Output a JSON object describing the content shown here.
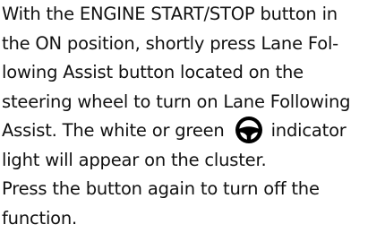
{
  "paragraph1": {
    "lines": [
      "With the ENGINE START/STOP button in",
      "the ON position, shortly press Lane Fol-",
      "lowing Assist button located on the",
      "steering wheel to turn on Lane Following"
    ],
    "line5_before_icon": "Assist. The white or green",
    "line5_after_icon": "indicator",
    "line6": "light will appear on the cluster."
  },
  "paragraph2": {
    "lines": [
      "Press the button again to turn off the",
      "function."
    ]
  },
  "icon": {
    "name": "steering-wheel-icon",
    "color": "#000000"
  }
}
